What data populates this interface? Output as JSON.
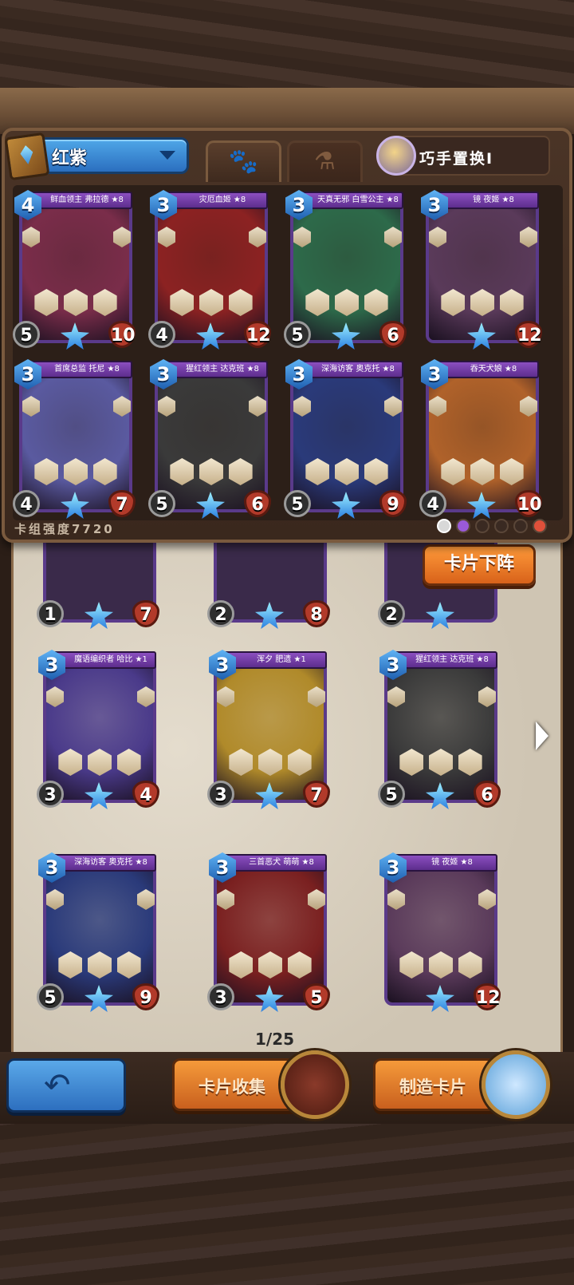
{
  "deck": {
    "name": "红紫",
    "swap_label": "巧手置换I",
    "strength_label": "卡组强度7720",
    "tabs": [
      "creature-tab",
      "potion-tab"
    ],
    "unequip_label": "卡片下阵"
  },
  "deck_cards": [
    {
      "name": "鲜血领主 弗拉德 ★8",
      "cost": "4",
      "attack": "5",
      "health": "10",
      "art": "#7a2d4a"
    },
    {
      "name": "灾厄血姬 ★8",
      "cost": "3",
      "attack": "4",
      "health": "12",
      "art": "#8c2222"
    },
    {
      "name": "天真无邪 白雪公主 ★8",
      "cost": "3",
      "attack": "5",
      "health": "6",
      "art": "#2d6a4a"
    },
    {
      "name": "镜 夜姬 ★8",
      "cost": "3",
      "attack": "",
      "health": "12",
      "art": "#5a3a5a"
    },
    {
      "name": "首席总监 托尼 ★8",
      "cost": "3",
      "attack": "4",
      "health": "7",
      "art": "#5a5aa0"
    },
    {
      "name": "猩红领主 达克班 ★8",
      "cost": "3",
      "attack": "5",
      "health": "6",
      "art": "#3a3a3a"
    },
    {
      "name": "深海访客 奥克托 ★8",
      "cost": "3",
      "attack": "5",
      "health": "9",
      "art": "#2a3a7a"
    },
    {
      "name": "吞天犬娘 ★8",
      "cost": "3",
      "attack": "4",
      "health": "10",
      "art": "#b0622a"
    }
  ],
  "partial_cards": [
    {
      "attack": "1",
      "health": "7"
    },
    {
      "attack": "2",
      "health": "8"
    },
    {
      "attack": "2",
      "health": ""
    }
  ],
  "collection_cards": [
    {
      "name": "魔语编织者 哈比 ★1",
      "cost": "3",
      "attack": "3",
      "health": "4",
      "art": "#4a3a8a"
    },
    {
      "name": "浑夕 肥遗 ★1",
      "cost": "3",
      "attack": "3",
      "health": "7",
      "art": "#b08a2a"
    },
    {
      "name": "猩红领主 达克班 ★8",
      "cost": "3",
      "attack": "5",
      "health": "6",
      "art": "#3a3a3a"
    },
    {
      "name": "深海访客 奥克托 ★8",
      "cost": "3",
      "attack": "5",
      "health": "9",
      "art": "#2a3a7a"
    },
    {
      "name": "三首恶犬 萌萌 ★8",
      "cost": "3",
      "attack": "3",
      "health": "5",
      "art": "#7a2020"
    },
    {
      "name": "镜 夜姬 ★8",
      "cost": "3",
      "attack": "",
      "health": "12",
      "art": "#5a3a5a"
    }
  ],
  "pager": "1/25",
  "buttons": {
    "collect_label": "卡片收集",
    "craft_label": "制造卡片",
    "back_icon": "back-arrow-icon"
  }
}
